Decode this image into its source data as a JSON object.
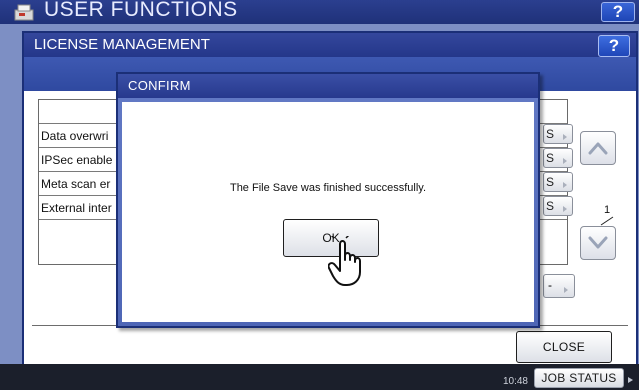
{
  "outer_window": {
    "title": "USER FUNCTIONS",
    "help_label": "?"
  },
  "license_panel": {
    "title": "LICENSE MANAGEMENT",
    "help_label": "?",
    "rows": [
      {
        "label": "Data overwri",
        "button": "S"
      },
      {
        "label": "IPSec enable",
        "button": "S"
      },
      {
        "label": "Meta scan er",
        "button": "S"
      },
      {
        "label": "External inter",
        "button": "S"
      }
    ],
    "partial_button_label": "-",
    "page": {
      "current": "1",
      "total": "1"
    },
    "close_label": "CLOSE"
  },
  "dialog": {
    "title": "CONFIRM",
    "message": "The File Save was finished successfully.",
    "ok_label": "OK"
  },
  "status_bar": {
    "time": "10:48",
    "job_status_label": "JOB STATUS"
  }
}
